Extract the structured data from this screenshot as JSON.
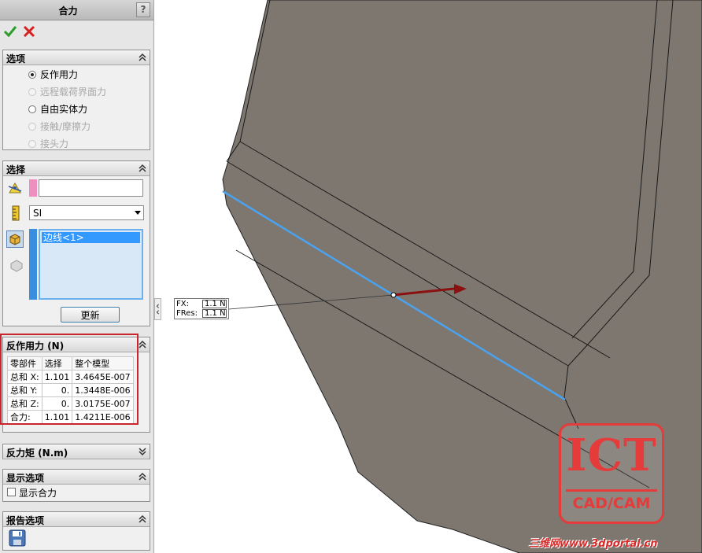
{
  "panel": {
    "title": "合力",
    "help_label": "?",
    "options": {
      "title": "选项",
      "items": [
        {
          "label": "反作用力",
          "selected": true,
          "enabled": true
        },
        {
          "label": "远程载荷界面力",
          "selected": false,
          "enabled": false
        },
        {
          "label": "自由实体力",
          "selected": false,
          "enabled": true
        },
        {
          "label": "接触/摩擦力",
          "selected": false,
          "enabled": false
        },
        {
          "label": "接头力",
          "selected": false,
          "enabled": false
        }
      ]
    },
    "selection": {
      "title": "选择",
      "text_value": "",
      "unit_value": "SI",
      "list_items": [
        "边线<1>"
      ],
      "update_label": "更新"
    },
    "reaction": {
      "title": "反作用力 (N)",
      "headers": [
        "零部件",
        "选择",
        "整个模型"
      ],
      "rows": [
        [
          "总和 X:",
          "1.101",
          "3.4645E-007"
        ],
        [
          "总和 Y:",
          "0.",
          "1.3448E-006"
        ],
        [
          "总和 Z:",
          "0.",
          "3.0175E-007"
        ],
        [
          "合力:",
          "1.101",
          "1.4211E-006"
        ]
      ]
    },
    "moment": {
      "title": "反力矩 (N.m)"
    },
    "display": {
      "title": "显示选项",
      "show_resultant_label": "显示合力",
      "checked": false
    },
    "report": {
      "title": "报告选项"
    }
  },
  "callout": {
    "fx_label": "FX:",
    "fx_value": "1.1 N",
    "fres_label": "FRes:",
    "fres_value": "1.1 N"
  },
  "logo": {
    "main": "ICT",
    "sub": "CAD/CAM"
  },
  "watermark": "三维网www.3dportal.cn",
  "colors": {
    "model_fill": "#7d7770",
    "edge_highlight": "#4aa3f0",
    "arrow": "#8b1010",
    "frame": "#c8262c"
  }
}
